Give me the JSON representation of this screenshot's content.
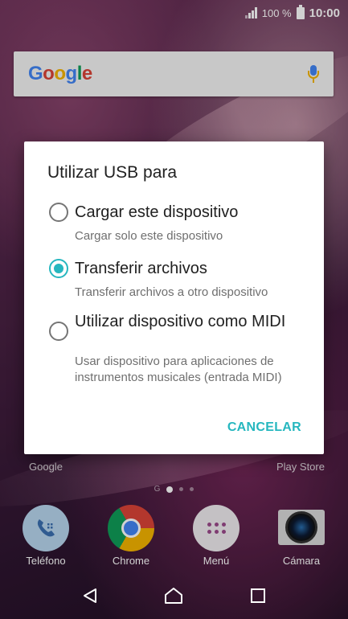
{
  "status_bar": {
    "battery_text": "100 %",
    "time": "10:00"
  },
  "search_widget": {
    "logo": "Google",
    "icons": [
      "google-logo",
      "mic-icon"
    ]
  },
  "dialog": {
    "title": "Utilizar USB para",
    "options": [
      {
        "label": "Cargar este dispositivo",
        "description": "Cargar solo este dispositivo",
        "selected": false
      },
      {
        "label": "Transferir archivos",
        "description": "Transferir archivos a otro dispositivo",
        "selected": true
      },
      {
        "label": "Utilizar dispositivo como MIDI",
        "description": "Usar dispositivo para aplicaciones de instrumentos musicales (entrada MIDI)",
        "selected": false
      }
    ],
    "cancel_label": "CANCELAR",
    "accent_color": "#26b7bf"
  },
  "home": {
    "folder_labels": [
      "Google",
      "Play Store"
    ],
    "page_indicator": "G"
  },
  "dock": [
    {
      "label": "Teléfono",
      "icon": "phone-icon"
    },
    {
      "label": "Chrome",
      "icon": "chrome-icon"
    },
    {
      "label": "Menú",
      "icon": "app-menu-icon"
    },
    {
      "label": "Cámara",
      "icon": "camera-icon"
    }
  ],
  "nav_bar": {
    "icons": [
      "back-icon",
      "home-icon",
      "recents-icon"
    ]
  }
}
